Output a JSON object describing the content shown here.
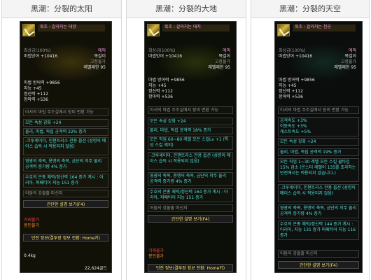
{
  "columns": [
    {
      "header": "黑潮：分裂的太阳",
      "item_name": "흑조 : 갈라지는 태양",
      "grade": "최상급(100%)",
      "defense_top": "마법방어 +10416",
      "rarity": "에픽",
      "slot": "목걸이",
      "bound": "고정불가",
      "req_level": "레벨제한 95",
      "stats": [
        "마법 방어력 +9856",
        "지능 +45",
        "정신력 +112",
        "항마력 +536"
      ],
      "option_note": "아서의 마법 주조실에서 장비 변환 가능",
      "elem": "모든 속성 강화 +24",
      "dmg": "물리, 마법, 독립 공격력 22% 증가",
      "skill_opts": "-크루세이더, 인챈트리스 전용 옵션 (성령의 메이스 습득 시 적용되지 않음)",
      "buff1": "영광의 축복, 용맹의 축복, 금단의 저주 물리 공격력 증가량 4% 증가",
      "buff2": "수호의 은총 체력/정신력 164 증가 계시 : 아리아, 퍼페티어 지능 151 증가",
      "set_name": "어둠의 강물줄 마신지",
      "btn_simple": "간단한 설명 보기(F4)",
      "unsell": "거래불가",
      "seal": "봉인불가",
      "btn_switch": "던전 정보(결투장 정보 전환: Home키)",
      "weight": "0.4kg",
      "price": "22,624골드"
    },
    {
      "header": "黑潮：分裂的大地",
      "item_name": "흑조 : 갈라지는 대지",
      "grade": "최상급(100%)",
      "defense_top": "마법방어 +10416",
      "rarity": "에픽",
      "slot": "목걸이",
      "bound": "고정불가",
      "req_level": "레벨제한 95",
      "stats": [
        "마법 방어력 +9856",
        "지능 +45",
        "정신력 +112",
        "항마력 +536"
      ],
      "option_note": "아서의 마법 주조실에서 장비 변환 가능",
      "elem": "모든 속성 강화 +24",
      "dmg": "물리, 마법, 독립 공격력 18% 증가",
      "skill_opts": "모든 직업 60~80 레벨 모든 스킬Lv +1 (특성 스킬 제외)",
      "skill_opts2": "-크루세이더, 인챈트리스 전용 옵션 (성령의 메이스 습득 시 적용되지 않음)",
      "buff1": "영광의 축복, 용맹의 축복, 금단의 저주 물리 공격력 증가량 4% 증가",
      "buff2": "수호의 은총 체력/정신력 164 증가 계시 : 아리아, 퍼페티어 지능 151 증가",
      "set_name": "어둠의 강물줄 마신지",
      "btn_simple": "간단한 설명 보기(F4)",
      "unsell": "거래불가",
      "seal": "봉인불가",
      "btn_switch": "던전 정보(결투장 정보 전환: Home키)"
    },
    {
      "header": "黑潮：分裂的天空",
      "item_name": "흑조 : 갈라지는 천공",
      "grade": "최상급(100%)",
      "defense_top": "마법방어 +10416",
      "rarity": "에픽",
      "slot": "목걸이",
      "bound": "고정불가",
      "req_level": "레벨제한 95",
      "stats": [
        "마법 방어력 +9856",
        "지능 +45",
        "정신력 +112",
        "항마력 +536"
      ],
      "option_note": "아서의 마법 주조실에서 장비 변환 가능",
      "extra": [
        "공격속도 +3%",
        "이동속도 +3%",
        "캐스트속도 +5%"
      ],
      "elem": "모든 속성 강화 +24",
      "dmg": "물리, 마법, 독립 공격력 19% 증가",
      "skill_opts": "모든 직업 1~30 레벨 모든 스킬 쿨타임 15% 감소 (온스터 레벨이 135를 초과하는 던전에서는 적용되지 않습니다.)",
      "skill_opts2": "-크루세이더, 인챈트리스 전용 옵션 (성령의 메이스 습득 시 적용되지 않음)",
      "buff1": "영광의 축복, 용맹의 축복, 금단의 저주 물리 공격력 증가량 4% 증가",
      "buff2": "수호의 은총 체력/정신력 144 증가 계시 : 아리아, 지능 131 증가 퍼페티어 지능 116 증가",
      "set_name": "어둠의 강물줄 마신지",
      "btn_simple": "간단한 설명 보기(F4)"
    }
  ]
}
